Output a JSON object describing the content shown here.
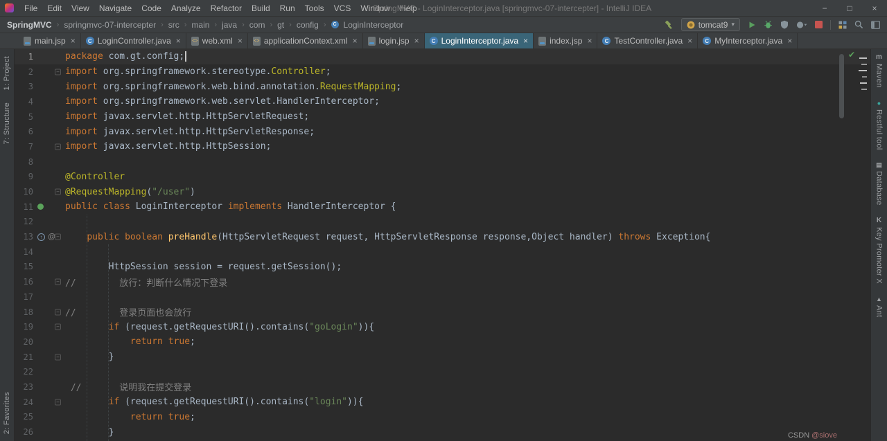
{
  "window": {
    "title": "SpringMVC - LoginInterceptor.java [springmvc-07-intercepter] - IntelliJ IDEA",
    "menus": [
      "File",
      "Edit",
      "View",
      "Navigate",
      "Code",
      "Analyze",
      "Refactor",
      "Build",
      "Run",
      "Tools",
      "VCS",
      "Window",
      "Help"
    ],
    "controls": {
      "minimize": "−",
      "maximize": "□",
      "close": "×"
    }
  },
  "breadcrumbs": [
    "SpringMVC",
    "springmvc-07-intercepter",
    "src",
    "main",
    "java",
    "com",
    "gt",
    "config",
    "LoginInterceptor"
  ],
  "toolbar": {
    "run_config": "tomcat9",
    "icons": [
      "build-hammer-icon",
      "tomcat-icon",
      "run-icon",
      "debug-icon",
      "coverage-icon",
      "profiler-icon",
      "stop-icon",
      "services-icon",
      "search-everywhere-icon",
      "layout-icon"
    ]
  },
  "tabs": [
    {
      "label": "main.jsp",
      "type": "jsp",
      "active": false
    },
    {
      "label": "LoginController.java",
      "type": "class",
      "active": false
    },
    {
      "label": "web.xml",
      "type": "xml",
      "active": false
    },
    {
      "label": "applicationContext.xml",
      "type": "xml",
      "active": false
    },
    {
      "label": "login.jsp",
      "type": "jsp",
      "active": false
    },
    {
      "label": "LoginInterceptor.java",
      "type": "class",
      "active": true
    },
    {
      "label": "index.jsp",
      "type": "jsp",
      "active": false
    },
    {
      "label": "TestController.java",
      "type": "class",
      "active": false
    },
    {
      "label": "MyInterceptor.java",
      "type": "class",
      "active": false
    }
  ],
  "left_strip": {
    "top": [
      "1: Project",
      "7: Structure"
    ],
    "bottom": [
      "2: Favorites"
    ]
  },
  "right_strip": [
    {
      "icon": "maven-icon",
      "label": "Maven"
    },
    {
      "icon": "restful-tool-icon",
      "label": "Restful tool"
    },
    {
      "icon": "database-icon",
      "label": "Database"
    },
    {
      "icon": "key-promoter-icon",
      "label": "Key Promoter X"
    },
    {
      "icon": "ant-icon",
      "label": "Ant"
    }
  ],
  "watermark": {
    "brand": "CSDN",
    "user": "@siove"
  },
  "editor": {
    "file": "LoginInterceptor.java",
    "lines": [
      {
        "n": 1,
        "current": true,
        "caret": true,
        "t": [
          [
            "k",
            "package"
          ],
          [
            "p",
            " com.gt.config;"
          ]
        ]
      },
      {
        "n": 2,
        "fold": true,
        "t": [
          [
            "k",
            "import"
          ],
          [
            "p",
            " org.springframework.stereotype."
          ],
          [
            "a",
            "Controller"
          ],
          [
            "p",
            ";"
          ]
        ]
      },
      {
        "n": 3,
        "t": [
          [
            "k",
            "import"
          ],
          [
            "p",
            " org.springframework.web.bind.annotation."
          ],
          [
            "a",
            "RequestMapping"
          ],
          [
            "p",
            ";"
          ]
        ]
      },
      {
        "n": 4,
        "t": [
          [
            "k",
            "import"
          ],
          [
            "p",
            " org.springframework.web.servlet.HandlerInterceptor;"
          ]
        ]
      },
      {
        "n": 5,
        "t": [
          [
            "k",
            "import"
          ],
          [
            "p",
            " javax.servlet.http.HttpServletRequest;"
          ]
        ]
      },
      {
        "n": 6,
        "t": [
          [
            "k",
            "import"
          ],
          [
            "p",
            " javax.servlet.http.HttpServletResponse;"
          ]
        ]
      },
      {
        "n": 7,
        "fold": true,
        "t": [
          [
            "k",
            "import"
          ],
          [
            "p",
            " javax.servlet.http.HttpSession;"
          ]
        ]
      },
      {
        "n": 8,
        "t": []
      },
      {
        "n": 9,
        "t": [
          [
            "a",
            "@Controller"
          ]
        ]
      },
      {
        "n": 10,
        "fold": true,
        "t": [
          [
            "a",
            "@RequestMapping"
          ],
          [
            "p",
            "("
          ],
          [
            "s",
            "\"/user\""
          ],
          [
            "p",
            ")"
          ]
        ]
      },
      {
        "n": 11,
        "icons": [
          "bean"
        ],
        "t": [
          [
            "k",
            "public class"
          ],
          [
            "p",
            " LoginInterceptor "
          ],
          [
            "k",
            "implements"
          ],
          [
            "p",
            " HandlerInterceptor {"
          ]
        ]
      },
      {
        "n": 12,
        "t": []
      },
      {
        "n": 13,
        "fold": true,
        "icons": [
          "override",
          "at"
        ],
        "t": [
          [
            "p",
            "    "
          ],
          [
            "k",
            "public"
          ],
          [
            "p",
            " "
          ],
          [
            "k",
            "boolean"
          ],
          [
            "p",
            " "
          ],
          [
            "m",
            "preHandle"
          ],
          [
            "p",
            "(HttpServletRequest request, HttpServletResponse response,Object handler) "
          ],
          [
            "k",
            "throws"
          ],
          [
            "p",
            " Exception{"
          ]
        ]
      },
      {
        "n": 14,
        "t": []
      },
      {
        "n": 15,
        "t": [
          [
            "p",
            "        HttpSession session = request.getSession();"
          ]
        ]
      },
      {
        "n": 16,
        "fold": true,
        "t": [
          [
            "c",
            "//        放行：判断什么情况下登录"
          ]
        ]
      },
      {
        "n": 17,
        "t": []
      },
      {
        "n": 18,
        "fold": true,
        "t": [
          [
            "c",
            "//        登录页面也会放行"
          ]
        ]
      },
      {
        "n": 19,
        "fold": true,
        "t": [
          [
            "p",
            "        "
          ],
          [
            "k",
            "if"
          ],
          [
            "p",
            " (request.getRequestURI().contains("
          ],
          [
            "s",
            "\"goLogin\""
          ],
          [
            "p",
            ")){"
          ]
        ]
      },
      {
        "n": 20,
        "t": [
          [
            "p",
            "            "
          ],
          [
            "k",
            "return"
          ],
          [
            "p",
            " "
          ],
          [
            "k",
            "true"
          ],
          [
            "p",
            ";"
          ]
        ]
      },
      {
        "n": 21,
        "fold": true,
        "t": [
          [
            "p",
            "        }"
          ]
        ]
      },
      {
        "n": 22,
        "t": []
      },
      {
        "n": 23,
        "t": [
          [
            "c",
            " //       说明我在提交登录"
          ]
        ]
      },
      {
        "n": 24,
        "fold": true,
        "t": [
          [
            "p",
            "        "
          ],
          [
            "k",
            "if"
          ],
          [
            "p",
            " (request.getRequestURI().contains("
          ],
          [
            "s",
            "\"login\""
          ],
          [
            "p",
            ")){"
          ]
        ]
      },
      {
        "n": 25,
        "t": [
          [
            "p",
            "            "
          ],
          [
            "k",
            "return"
          ],
          [
            "p",
            " "
          ],
          [
            "k",
            "true"
          ],
          [
            "p",
            ";"
          ]
        ]
      },
      {
        "n": 26,
        "t": [
          [
            "p",
            "        }"
          ]
        ]
      }
    ]
  },
  "colors": {
    "background": "#2b2b2b",
    "panel": "#3c3f41",
    "keyword": "#cc7832",
    "plain": "#a9b7c6",
    "annotation": "#bbb529",
    "string": "#6a8759",
    "comment": "#808080",
    "method": "#ffc66d",
    "line_number": "#606366",
    "active_tab": "#3a6578",
    "accent_green": "#5BA35B",
    "stop_red": "#C75450"
  }
}
